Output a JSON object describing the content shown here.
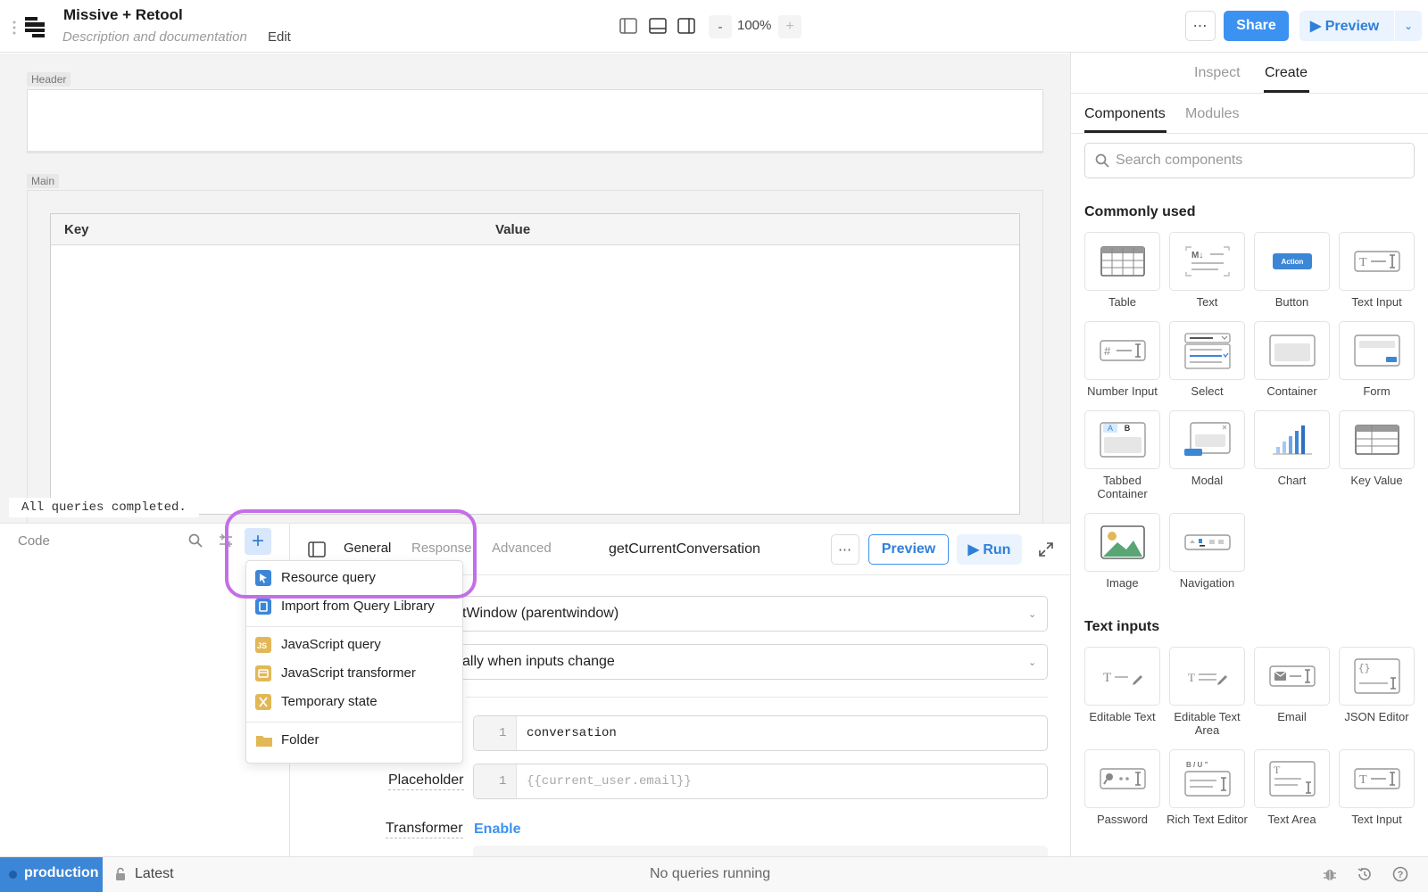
{
  "app": {
    "title": "Missive + Retool",
    "description": "Description and documentation",
    "edit_label": "Edit"
  },
  "toolbar": {
    "zoom_minus": "-",
    "zoom_value": "100%",
    "zoom_plus": "+",
    "more": "⋯",
    "share": "Share",
    "preview": "▶ Preview",
    "preview_menu": "⌄"
  },
  "canvas": {
    "header_tag": "Header",
    "main_tag": "Main",
    "table_columns": [
      "Key",
      "Value"
    ],
    "status": "All queries completed."
  },
  "code_panel": {
    "title": "Code",
    "add": "+"
  },
  "add_menu": {
    "items": [
      {
        "label": "Resource query",
        "icon": "resource-query-icon",
        "color": "#3c86d7"
      },
      {
        "label": "Import from Query Library",
        "icon": "query-library-icon",
        "color": "#3c86d7"
      },
      {
        "label": "JavaScript query",
        "icon": "javascript-query-icon",
        "color": "#e2b857"
      },
      {
        "label": "JavaScript transformer",
        "icon": "javascript-transformer-icon",
        "color": "#e2b857"
      },
      {
        "label": "Temporary state",
        "icon": "temporary-state-icon",
        "color": "#e2b857"
      },
      {
        "label": "Folder",
        "icon": "folder-icon",
        "color": "#e2b857"
      }
    ]
  },
  "editor": {
    "tabs": [
      "General",
      "Response",
      "Advanced"
    ],
    "query_name": "getCurrentConversation",
    "more": "⋯",
    "preview": "Preview",
    "run": "▶ Run",
    "resource_value": "tWindow (parentwindow)",
    "trigger_value": "ally when inputs change",
    "selector_line": "1",
    "selector_value": "conversation",
    "placeholder_label": "Placeholder",
    "placeholder_line": "1",
    "placeholder_value": "{{current_user.email}}",
    "transformer_label": "Transformer",
    "transformer_action": "Enable"
  },
  "right_panel": {
    "tabs": [
      "Inspect",
      "Create"
    ],
    "subtabs": [
      "Components",
      "Modules"
    ],
    "search_placeholder": "Search components",
    "commonly_used_heading": "Commonly used",
    "commonly_used": [
      "Table",
      "Text",
      "Button",
      "Text Input",
      "Number Input",
      "Select",
      "Container",
      "Form",
      "Tabbed Container",
      "Modal",
      "Chart",
      "Key Value",
      "Image",
      "Navigation"
    ],
    "button_thumb_text": "Action",
    "text_thumb_text": "M↓",
    "tabbed_thumb_a": "A",
    "tabbed_thumb_b": "B",
    "text_inputs_heading": "Text inputs",
    "text_inputs": [
      "Editable Text",
      "Editable Text Area",
      "Email",
      "JSON Editor",
      "Password",
      "Rich Text Editor",
      "Text Area",
      "Text Input"
    ],
    "rich_text_thumb_text": "B / U ”"
  },
  "bottom_bar": {
    "environment": "production",
    "version": "Latest",
    "status": "No queries running"
  },
  "colors": {
    "accent": "#3c92f0",
    "highlight_ring": "#c36fe6",
    "env_chip": "#3c86d7"
  }
}
